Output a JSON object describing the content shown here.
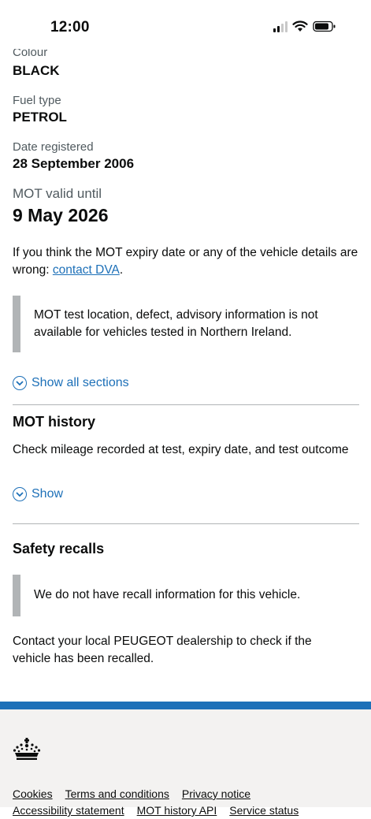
{
  "status_bar": {
    "time": "12:00"
  },
  "vehicle": {
    "colour_label": "Colour",
    "colour_value": "BLACK",
    "fuel_label": "Fuel type",
    "fuel_value": "PETROL",
    "registered_label": "Date registered",
    "registered_value": "28 September 2006",
    "mot_label": "MOT valid until",
    "mot_value": "9 May 2026"
  },
  "contact": {
    "text": "If you think the MOT expiry date or any of the vehicle details are wrong: ",
    "link": "contact DVA",
    "suffix": "."
  },
  "ni_notice": "MOT test location, defect, advisory information is not available for vehicles tested in Northern Ireland.",
  "show_all_sections": "Show all sections",
  "mot_history": {
    "heading": "MOT history",
    "summary": "Check mileage recorded at test, expiry date, and test outcome",
    "show": "Show"
  },
  "safety_recalls": {
    "heading": "Safety recalls",
    "notice": "We do not have recall information for this vehicle.",
    "advice": "Contact your local PEUGEOT dealership to check if the vehicle has been recalled."
  },
  "footer": {
    "links": [
      "Cookies",
      "Terms and conditions",
      "Privacy notice",
      "Accessibility statement",
      "MOT history API",
      "Service status"
    ]
  },
  "colors": {
    "link": "#1d70b8",
    "text": "#0b0c0c",
    "secondary": "#505a5f",
    "border": "#b1b4b6",
    "footer_bg": "#f3f2f1"
  }
}
